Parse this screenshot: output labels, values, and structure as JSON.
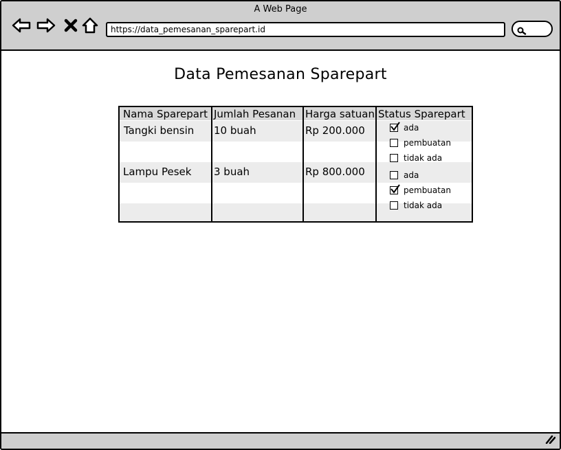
{
  "window": {
    "title": "A Web Page"
  },
  "browser": {
    "url": "https://data_pemesanan_sparepart.id",
    "icons": [
      "back-arrow-icon",
      "forward-arrow-icon",
      "close-x-icon",
      "home-icon",
      "search-icon"
    ]
  },
  "page": {
    "title": "Data Pemesanan Sparepart"
  },
  "table": {
    "headers": [
      "Nama Sparepart",
      "Jumlah Pesanan",
      "Harga satuan",
      "Status Sparepart"
    ],
    "rows": [
      {
        "nama": "Tangki bensin",
        "jumlah": "10 buah",
        "harga": "Rp 200.000",
        "status": [
          {
            "label": "ada",
            "checked": true
          },
          {
            "label": "pembuatan",
            "checked": false
          },
          {
            "label": "tidak ada",
            "checked": false
          }
        ]
      },
      {
        "nama": "Lampu Pesek",
        "jumlah": "3 buah",
        "harga": "Rp 800.000",
        "status": [
          {
            "label": "ada",
            "checked": false
          },
          {
            "label": "pembuatan",
            "checked": true
          },
          {
            "label": "tidak ada",
            "checked": false
          }
        ]
      }
    ]
  }
}
